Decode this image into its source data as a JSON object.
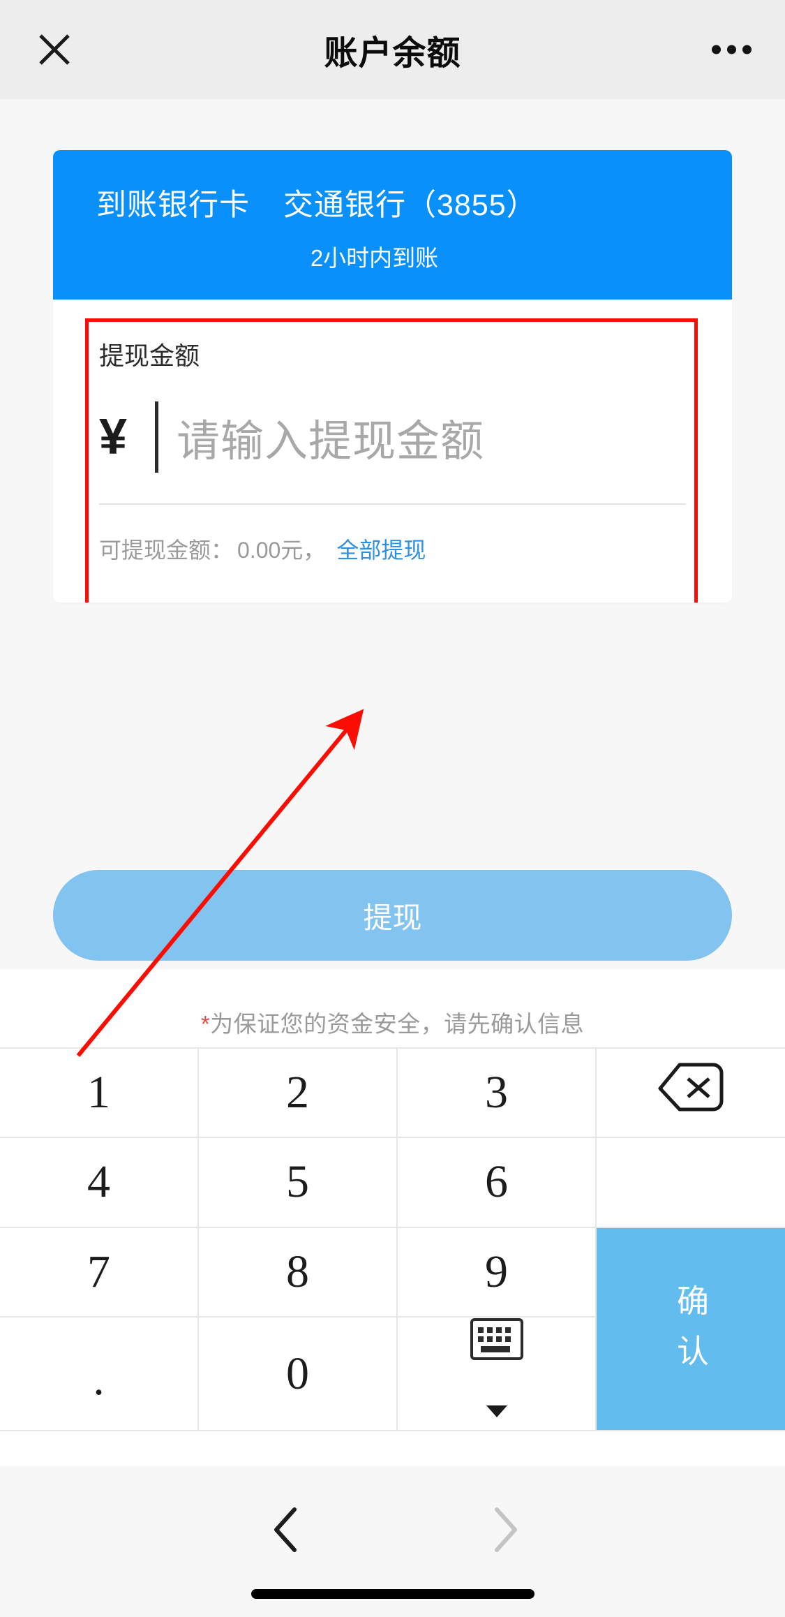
{
  "header": {
    "title": "账户余额",
    "close_icon": "close-icon",
    "more_icon": "more-options-icon"
  },
  "bank_card": {
    "label": "到账银行卡",
    "bank_name": "交通银行（3855）",
    "arrival_note": "2小时内到账",
    "background_color": "#0a90fb"
  },
  "amount_section": {
    "label": "提现金额",
    "currency_symbol": "¥",
    "input_value": "",
    "placeholder": "请输入提现金额",
    "balance_label": "可提现金额：",
    "balance_value": "0.00元，",
    "withdraw_all_link": "全部提现",
    "link_color": "#2f8fe0",
    "highlight_border_color": "#fb0d03"
  },
  "submit": {
    "label": "提现",
    "color": "#82c3ef"
  },
  "keyboard": {
    "notice_star": "*",
    "notice_text": "为保证您的资金安全，请先确认信息",
    "keys": [
      "1",
      "2",
      "3",
      "4",
      "5",
      "6",
      "7",
      "8",
      "9",
      ".",
      "0"
    ],
    "backspace_icon": "backspace-icon",
    "hide_keyboard_icon": "hide-keyboard-icon",
    "confirm_label": "确认",
    "confirm_color": "#62bdee"
  },
  "bottom_nav": {
    "back_icon": "chevron-left-icon",
    "forward_icon": "chevron-right-icon",
    "home_indicator": "home-indicator"
  }
}
